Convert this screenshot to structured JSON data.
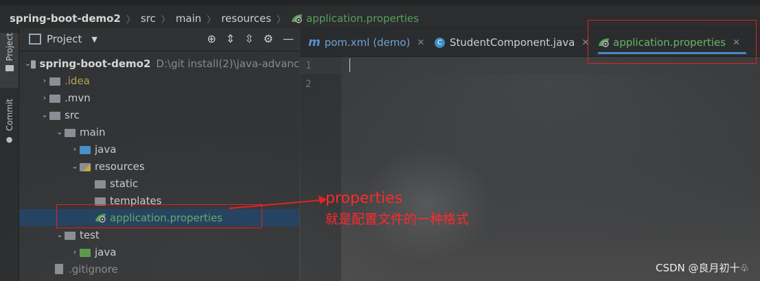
{
  "breadcrumb": {
    "project": "spring-boot-demo2",
    "parts": [
      "src",
      "main",
      "resources"
    ],
    "file": "application.properties"
  },
  "side_tabs": {
    "project": "Project",
    "commit": "Commit"
  },
  "panel": {
    "title": "Project"
  },
  "tree": [
    {
      "label": "spring-boot-demo2",
      "extra": "D:\\git install(2)\\java-advanc"
    },
    {
      "label": ".idea"
    },
    {
      "label": ".mvn"
    },
    {
      "label": "src"
    },
    {
      "label": "main"
    },
    {
      "label": "java"
    },
    {
      "label": "resources"
    },
    {
      "label": "static"
    },
    {
      "label": "templates"
    },
    {
      "label": "application.properties"
    },
    {
      "label": "test"
    },
    {
      "label": "java"
    },
    {
      "label": ".gitignore"
    }
  ],
  "tabs": [
    {
      "label": "pom.xml (demo)",
      "icon": "maven-icon"
    },
    {
      "label": "StudentComponent.java",
      "icon": "class-icon"
    },
    {
      "label": "application.properties",
      "icon": "spring-icon"
    }
  ],
  "editor": {
    "lines": [
      "1",
      "2"
    ]
  },
  "annotation": {
    "line1": "properties",
    "line2": "就是配置文件的一种格式"
  },
  "watermark": "CSDN @良月初十♧",
  "colors": {
    "annotation": "#ff2a2a",
    "selection": "#234669",
    "spring_green": "#5aa05a"
  }
}
